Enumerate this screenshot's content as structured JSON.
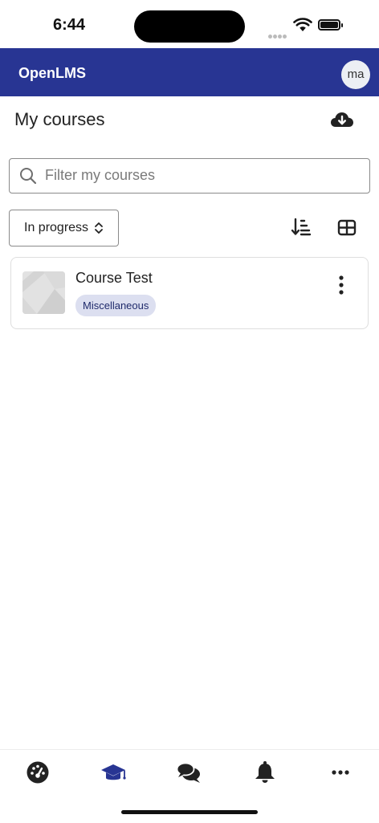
{
  "status_bar": {
    "time": "6:44"
  },
  "app_bar": {
    "title": "OpenLMS",
    "avatar_initials": "ma"
  },
  "page": {
    "title": "My courses"
  },
  "search": {
    "placeholder": "Filter my courses",
    "value": ""
  },
  "filter": {
    "selected": "In progress"
  },
  "courses": [
    {
      "name": "Course Test",
      "category": "Miscellaneous"
    }
  ],
  "tab_bar": {
    "items": [
      {
        "icon": "dashboard-icon",
        "active": false
      },
      {
        "icon": "graduation-cap-icon",
        "active": true
      },
      {
        "icon": "chat-bubbles-icon",
        "active": false
      },
      {
        "icon": "bell-icon",
        "active": false
      },
      {
        "icon": "more-icon",
        "active": false
      }
    ]
  },
  "colors": {
    "brand": "#283593",
    "badge_bg": "#dcdff0",
    "icon_dark": "#222222"
  }
}
